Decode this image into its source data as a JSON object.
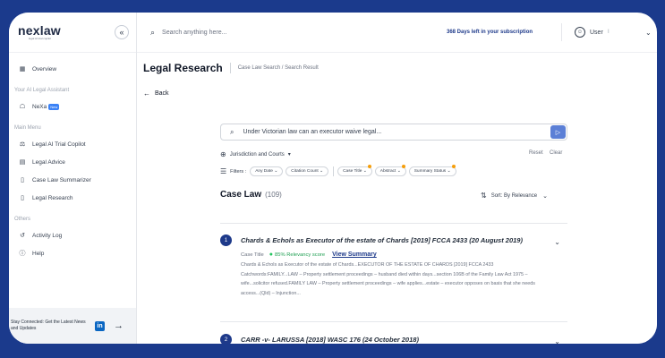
{
  "brand": {
    "name": "nexlaw",
    "tagline": "legal AI trial copilot"
  },
  "topbar": {
    "search_placeholder": "Search anything here...",
    "subscription": "368 Days left in your subscription",
    "user_label": "User",
    "user_sep": "I"
  },
  "sidebar": {
    "overview": "Overview",
    "assistant_section": "Your AI Legal Assistant",
    "nexa": "NeXa",
    "nexa_badge": "New",
    "main_menu_section": "Main Menu",
    "menu": [
      "Legal AI Trial Copilot",
      "Legal Advice",
      "Case Law Summarizer",
      "Legal Research"
    ],
    "others_section": "Others",
    "others": [
      "Activity Log",
      "Help"
    ],
    "stay_connected": "Stay Connected: Get the Latest News and Updates",
    "linkedin": "in"
  },
  "page": {
    "title": "Legal Research",
    "breadcrumb": "Case Law Search / Search Result",
    "back": "Back"
  },
  "search": {
    "query": "Under Victorian law can an executor waive legal...",
    "jurisdiction": "Jurisdiction and Courts",
    "reset": "Reset",
    "clear": "Clear",
    "filters_label": "Filters :",
    "filters_group1": [
      "Any Date",
      "Citation Count"
    ],
    "filters_group2": [
      "Case Title",
      "Abstract",
      "Summary Status"
    ]
  },
  "results_header": {
    "title": "Case Law",
    "count": "(109)",
    "sort": "Sort: By Relevance"
  },
  "results": [
    {
      "num": "1",
      "title": "Chards & Echols as Executor of the estate of Chards [2019] FCCA 2433 (20 August 2019)",
      "case_title_label": "Case Title",
      "relevancy": "85% Relevancy score",
      "view_summary": "View Summary",
      "body": "Chards & Echols as Executor of the estate of Chards...EXECUTOR OF THE ESTATE OF CHARDS [2019] FCCA 2433 Catchwords:FAMILY...LAW – Property settlement proceedings – husband died within days...section 106B of the Family Law Act 1975 – wife...solicitor refused.FAMILY LAW – Property settlement proceedings – wife applies...estate – executor opposes on basis that she needs access...(Qld) – Injunction..."
    },
    {
      "num": "2",
      "title": "CARR -v- LARUSSA [2018] WASC 176 (24 October 2018)"
    }
  ],
  "colors": {
    "frame_bg": "#1b3a8c",
    "accent": "#1e3a8a",
    "send_button": "#5b7fd6",
    "relevancy": "#22a054",
    "filter_dot": "#f59e0b"
  }
}
